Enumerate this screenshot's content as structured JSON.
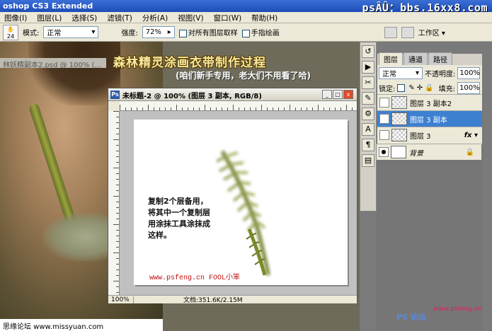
{
  "app": {
    "title": "oshop CS3 Extended",
    "watermark": "psÂÛ：bbs.16xx8.com"
  },
  "menu": {
    "items": [
      "图像(I)",
      "图层(L)",
      "选择(S)",
      "滤镜(T)",
      "分析(A)",
      "视图(V)",
      "窗口(W)",
      "帮助(H)"
    ]
  },
  "options": {
    "brush_size": "24",
    "mode_label": "模式:",
    "mode_value": "正常",
    "strength_label": "强度:",
    "strength_value": "72%",
    "sample_all_label": "对所有图层取样",
    "finger_paint_label": "手指绘画",
    "workspace_label": "工作区 ▾"
  },
  "background_doc": {
    "title": "林妖精副本2.psd @ 100% (..."
  },
  "banner": {
    "title": "森林精灵涂画衣带制作过程",
    "subtitle": "(咱们新手专用，老大们不用看了哈)"
  },
  "doc": {
    "title": "未标题-2 @ 100% (图层 3 副本, RGB/8)",
    "zoom": "100%",
    "file_info": "文档:351.6K/2.15M",
    "note_lines": [
      "复制2个层备用，",
      "将其中一个复制层",
      "用涂抹工具涂抹成",
      "这样。"
    ],
    "credit": "www.psfeng.cn   FOOL小笨"
  },
  "layers_panel": {
    "tabs": [
      "图层",
      "通道",
      "路径"
    ],
    "blend_mode": "正常",
    "opacity_label": "不透明度:",
    "opacity_value": "100%",
    "lock_label": "锁定:",
    "fill_label": "填充:",
    "fill_value": "100%",
    "layers": [
      {
        "name": "图层 3 副本2",
        "visible": false,
        "selected": false,
        "fx": false
      },
      {
        "name": "图层 3 副本",
        "visible": true,
        "selected": true,
        "fx": false
      },
      {
        "name": "图层 3",
        "visible": false,
        "selected": false,
        "fx": true
      },
      {
        "name": "背景",
        "visible": true,
        "selected": false,
        "fx": false
      }
    ]
  },
  "footer": {
    "left_text": "思缘论坛 www.missyuan.com",
    "right_logo": "PS 论坛",
    "right_url": "www.psfeng.cn"
  },
  "colors": {
    "titlebar": "#1e4db8",
    "selected_layer": "#3d80d0",
    "credit_red": "#c01010",
    "banner_yellow": "#f6e9a0"
  }
}
